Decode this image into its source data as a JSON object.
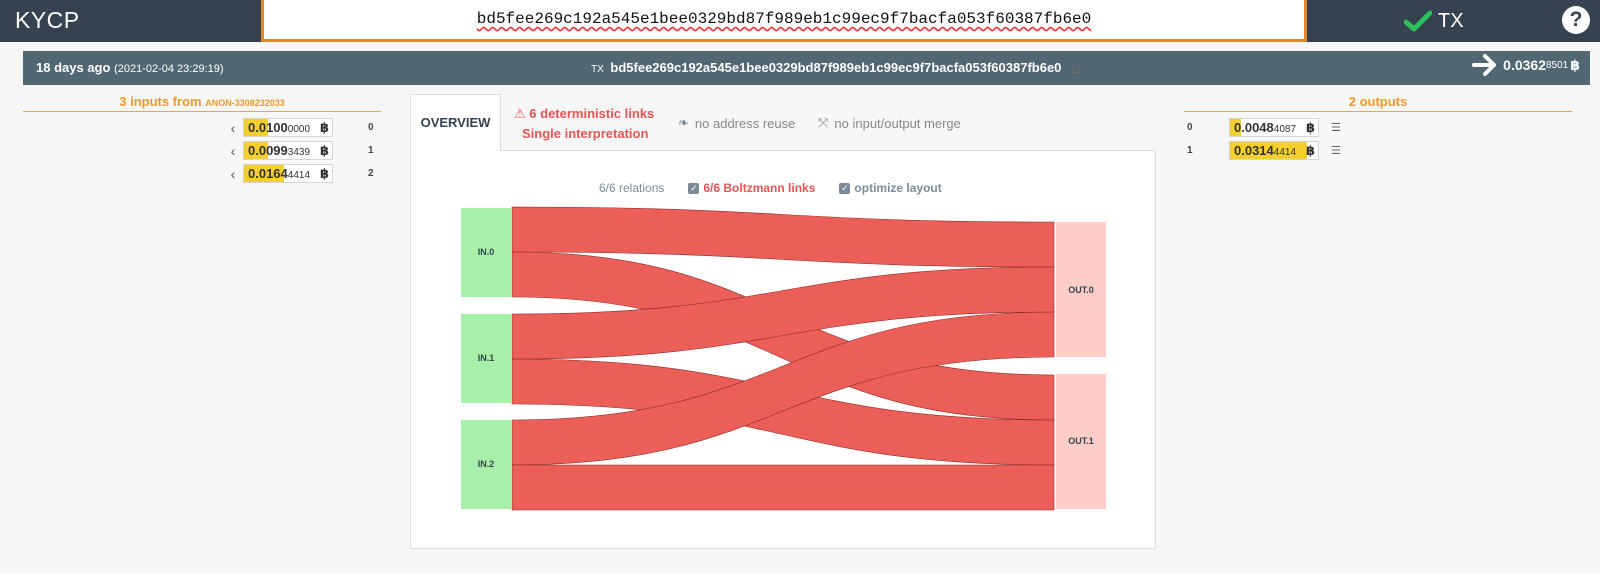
{
  "header": {
    "brand": "KYCP",
    "search_value": "bd5fee269c192a545e1bee0329bd87f989eb1c99ec9f7bacfa053f60387fb6e0",
    "tx_status": "TX",
    "help": "?"
  },
  "info": {
    "age": "18 days ago",
    "datetime": "(2021-02-04 23:29:19)",
    "tx_label": "TX",
    "tx_hash": "bd5fee269c192a545e1bee0329bd87f989eb1c99ec9f7bacfa053f60387fb6e0",
    "total_major": "0.0362",
    "total_minor": "8501",
    "coin": "฿"
  },
  "inputs": {
    "title": "3 inputs from",
    "source": "ANON-3308232033",
    "items": [
      {
        "major": "0.0100",
        "minor": "0000",
        "index": "0",
        "fill": 0.27
      },
      {
        "major": "0.0099",
        "minor": "3439",
        "index": "1",
        "fill": 0.27
      },
      {
        "major": "0.0164",
        "minor": "4414",
        "index": "2",
        "fill": 0.45
      }
    ]
  },
  "outputs": {
    "title": "2 outputs",
    "items": [
      {
        "major": "0.0048",
        "minor": "4087",
        "index": "0",
        "fill": 0.13
      },
      {
        "major": "0.0314",
        "minor": "4414",
        "index": "1",
        "fill": 0.87
      }
    ]
  },
  "tabs": {
    "overview": "OVERVIEW",
    "det_links": "6 deterministic links",
    "interpretation": "Single interpretation",
    "no_reuse": "no address reuse",
    "no_merge": "no input/output merge"
  },
  "graph": {
    "relations": "6/6 relations",
    "boltzmann": "6/6 Boltzmann links",
    "optimize": "optimize layout",
    "nodes": {
      "in0": "IN.0",
      "in1": "IN.1",
      "in2": "IN.2",
      "out0": "OUT.0",
      "out1": "OUT.1"
    }
  },
  "colors": {
    "topbar": "#34434f",
    "infobar": "#516873",
    "accent": "#e89a2a",
    "link": "#ec5f59",
    "input_node": "#a8efaa",
    "output_node": "#fdcdc8",
    "amount_fill": "#f5cf2b"
  }
}
